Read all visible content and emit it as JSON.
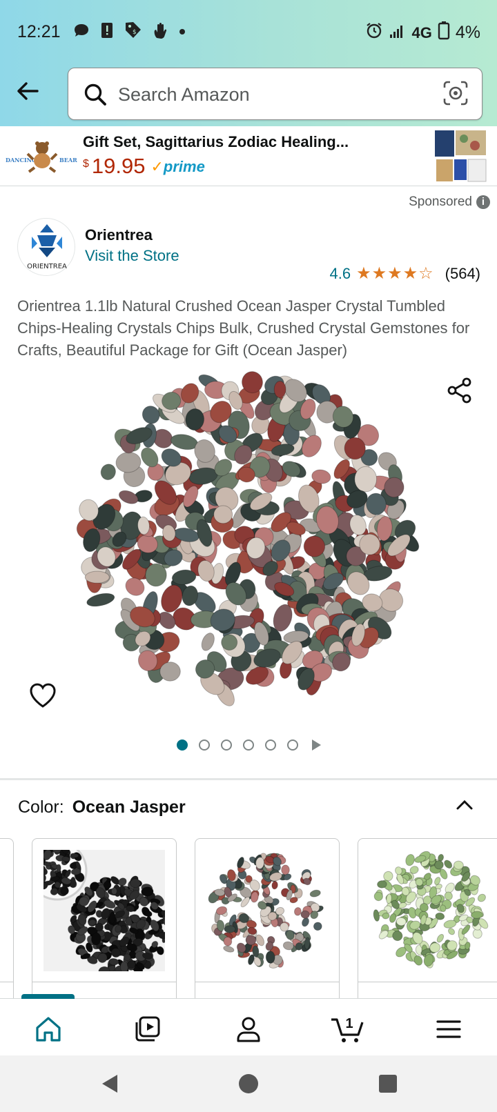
{
  "status_bar": {
    "time": "12:21",
    "network": "4G",
    "battery": "4%",
    "icons": [
      "chat-bubble-icon",
      "alert-icon",
      "tag-icon",
      "hand-wave-icon",
      "dot-icon",
      "alarm-icon",
      "signal-icon",
      "battery-icon"
    ]
  },
  "header": {
    "search_placeholder": "Search Amazon",
    "back_icon": "back-arrow-icon",
    "search_icon": "magnifier-icon",
    "camera_icon": "camera-lens-icon"
  },
  "sponsored_banner": {
    "brand_logo_text_left": "DANCING",
    "brand_logo_text_right": "BEAR",
    "title": "Gift Set, Sagittarius Zodiac Healing...",
    "currency": "$",
    "price": "19.95",
    "prime": "prime"
  },
  "sponsored_label": "Sponsored",
  "store": {
    "logo_text": "ORIENTREA",
    "name": "Orientrea",
    "visit_link": "Visit the Store"
  },
  "rating": {
    "value": "4.6",
    "stars": "★★★★☆",
    "count": "(564)"
  },
  "product_title": "Orientrea 1.1lb Natural Crushed Ocean Jasper Crystal Tumbled Chips-Healing Crystals Chips Bulk, Crushed Crystal Gemstones for Crafts, Beautiful Package for Gift (Ocean Jasper)",
  "carousel": {
    "active_index": 0,
    "dot_count": 6
  },
  "variation": {
    "label": "Color:",
    "value": "Ocean Jasper",
    "swatches": [
      "partial-left",
      "black-obsidian",
      "ocean-jasper",
      "green-prehnite"
    ]
  },
  "bottom_nav": {
    "items": [
      "home-icon",
      "video-icon",
      "account-icon",
      "cart-icon",
      "menu-icon"
    ],
    "cart_count": "1",
    "active": "home"
  },
  "colors": {
    "accent": "#007185",
    "price": "#b12704",
    "star": "#de7921",
    "prime": "#1399c6"
  }
}
